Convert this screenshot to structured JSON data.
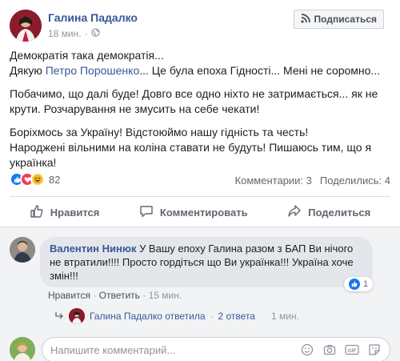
{
  "post": {
    "author": "Галина Падалко",
    "time": "18 мин.",
    "subscribe_label": "Подписаться",
    "line1": "Демократія така демократія...",
    "line2_pre": "Дякую ",
    "line2_link": "Петро Порошенко",
    "line2_post": "... Це була епоха Гідності... Мені не соромно...",
    "para2": "Побачимо, що далі буде! Довго все одно ніхто не затримається... як не крути. Розчарування не змусить на себе чекати!",
    "para3_l1": "Боріхмось за Україну! Відстоюймо нашу гідність та честь!",
    "para3_l2": "Народжені вільними на коліна ставати не будуть! Пишаюсь тим, що я українка!"
  },
  "stats": {
    "reaction_count": "82",
    "comments": "Комментарии: 3",
    "shares": "Поделились: 4"
  },
  "actions": {
    "like": "Нравится",
    "comment": "Комментировать",
    "share": "Поделиться"
  },
  "comment": {
    "author": "Валентин Нинюк",
    "text": " У Вашу епоху Галина разом з БАП Ви нічого не втратили!!!! Просто гордіться що Ви українка!!! Україна хоче змін!!!",
    "like_label": "Нравится",
    "reply_label": "Ответить",
    "time": "15 мин.",
    "like_count": "1"
  },
  "reply": {
    "text": "Галина Падалко ответила",
    "count": "2 ответа",
    "time": "1 мин."
  },
  "composer": {
    "placeholder": "Напишите комментарий..."
  }
}
